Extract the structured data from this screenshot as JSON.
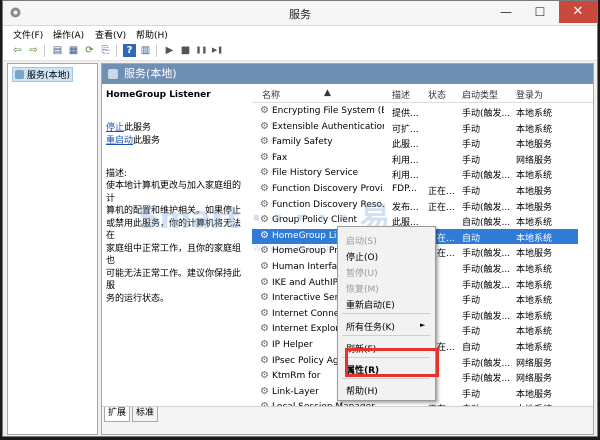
{
  "window": {
    "title": "服务",
    "min": "—",
    "max": "☐",
    "close": "✕"
  },
  "menu": [
    "文件(F)",
    "操作(A)",
    "查看(V)",
    "帮助(H)"
  ],
  "toolbar": {
    "icons": [
      "back-icon",
      "forward-icon",
      "show-console-tree-icon",
      "properties-icon",
      "refresh-icon",
      "export-list-icon",
      "help-icon",
      "show-action-pane-icon",
      "start-icon",
      "stop-icon",
      "pause-icon",
      "restart-icon"
    ],
    "glyphs": {
      "back": "⇦",
      "forward": "⇨",
      "console": "▤",
      "props": "▦",
      "refresh": "⟳",
      "export": "⎘",
      "help": "?",
      "pane": "▥",
      "start": "▶",
      "stop": "■",
      "pause": "❚❚",
      "restart": "▶❚"
    }
  },
  "tree": {
    "root_label": "服务(本地)"
  },
  "main": {
    "header": "服务(本地)",
    "selected_service": "HomeGroup Listener",
    "stop_link": "停止",
    "stop_suffix": "此服务",
    "restart_link": "重启动",
    "restart_suffix": "此服务",
    "desc_label": "描述:",
    "desc_lines": [
      "使本地计算机更改与加入家庭组的计",
      "算机的配置和维护相关。如果停止",
      "或禁用此服务，你的计算机将无法在",
      "家庭组中正常工作，且你的家庭组也",
      "可能无法正常工作。建议你保持此服",
      "务的运行状态。"
    ]
  },
  "columns": {
    "name": "名称",
    "desc": "描述",
    "status": "状态",
    "startup": "启动类型",
    "logon": "登录为"
  },
  "services": [
    {
      "name": "Encrypting File System (E...",
      "desc": "提供...",
      "status": "",
      "startup": "手动(触发...",
      "logon": "本地系统"
    },
    {
      "name": "Extensible Authentication...",
      "desc": "可扩...",
      "status": "",
      "startup": "手动",
      "logon": "本地系统"
    },
    {
      "name": "Family Safety",
      "desc": "此服...",
      "status": "",
      "startup": "手动",
      "logon": "本地服务"
    },
    {
      "name": "Fax",
      "desc": "利用...",
      "status": "",
      "startup": "手动",
      "logon": "网络服务"
    },
    {
      "name": "File History Service",
      "desc": "利用...",
      "status": "",
      "startup": "手动(触发...",
      "logon": "本地系统"
    },
    {
      "name": "Function Discovery Provi...",
      "desc": "FDP...",
      "status": "正在...",
      "startup": "手动",
      "logon": "本地服务"
    },
    {
      "name": "Function Discovery Reso...",
      "desc": "发布...",
      "status": "正在...",
      "startup": "手动(触发...",
      "logon": "本地服务"
    },
    {
      "name": "Group Policy Client",
      "desc": "此服...",
      "status": "",
      "startup": "自动(触发...",
      "logon": "本地系统"
    },
    {
      "name": "HomeGroup Listener",
      "desc": "",
      "status": "正在...",
      "startup": "自动",
      "logon": "本地系统"
    },
    {
      "name": "HomeGroup Provider",
      "desc": "",
      "status": "正在...",
      "startup": "手动(触发...",
      "logon": "本地服务"
    },
    {
      "name": "Human Interface Device",
      "desc": "",
      "status": "",
      "startup": "手动(触发...",
      "logon": "本地系统"
    },
    {
      "name": "IKE and AuthIP IPsec",
      "desc": "",
      "status": "",
      "startup": "手动(触发...",
      "logon": "本地系统"
    },
    {
      "name": "Interactive Services",
      "desc": "",
      "status": "",
      "startup": "手动",
      "logon": "本地系统"
    },
    {
      "name": "Internet Connection",
      "desc": "",
      "status": "",
      "startup": "手动(触发...",
      "logon": "本地系统"
    },
    {
      "name": "Internet Explorer",
      "desc": "",
      "status": "",
      "startup": "手动",
      "logon": "本地系统"
    },
    {
      "name": "IP Helper",
      "desc": "",
      "status": "正在...",
      "startup": "自动",
      "logon": "本地系统"
    },
    {
      "name": "IPsec Policy Agent",
      "desc": "",
      "status": "",
      "startup": "手动(触发...",
      "logon": "网络服务"
    },
    {
      "name": "KtmRm for",
      "desc": "",
      "status": "",
      "startup": "手动(触发...",
      "logon": "网络服务"
    },
    {
      "name": "Link-Layer",
      "desc": "",
      "status": "",
      "startup": "手动",
      "logon": "本地服务"
    },
    {
      "name": "Local Session Manager",
      "desc": "",
      "status": "正在...",
      "startup": "自动",
      "logon": "本地系统"
    }
  ],
  "context_menu": {
    "start": "启动(S)",
    "stop": "停止(O)",
    "pause": "暂停(U)",
    "resume": "恢复(M)",
    "restart": "重新启动(E)",
    "all_tasks": "所有任务(K)",
    "refresh": "刷新(F)",
    "properties": "属性(R)",
    "help": "帮助(H)",
    "submenu_arrow": "►"
  },
  "tabs": {
    "extended": "扩展",
    "standard": "标准"
  },
  "colors": {
    "header_bar": "#6f8fb3",
    "selection": "#2f7bd6",
    "highlight_box": "#e8322f"
  }
}
